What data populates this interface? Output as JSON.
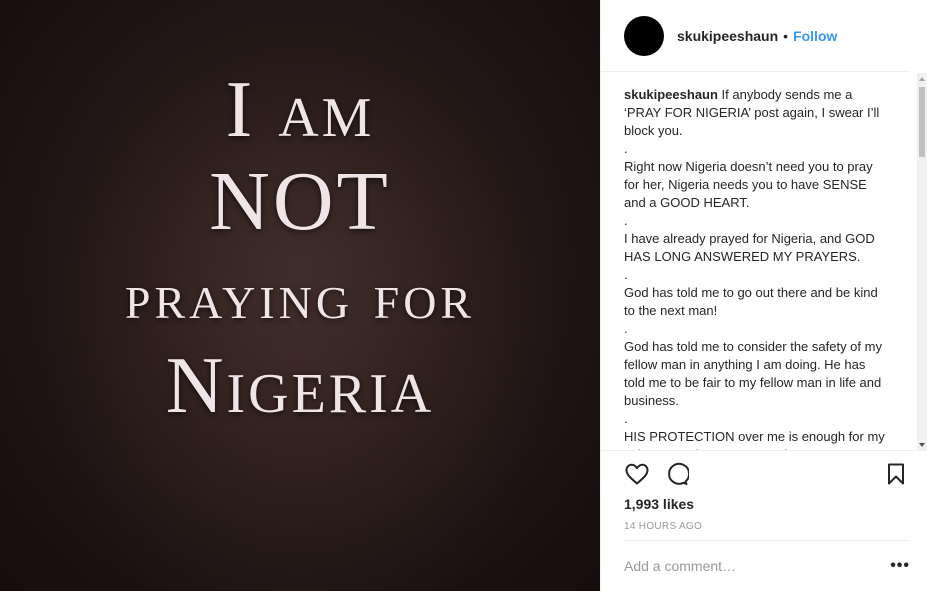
{
  "image": {
    "lines": [
      "I am",
      "NOT",
      "praying for",
      "Nigeria"
    ]
  },
  "header": {
    "username": "skukipeeshaun",
    "separator": "•",
    "follow_label": "Follow"
  },
  "caption": {
    "username": "skukipeeshaun",
    "text": " If anybody sends me a ‘PRAY FOR NIGERIA’ post again, I swear I’ll block you.\n.\nRight now Nigeria doesn’t need you to pray for her, Nigeria needs you to have SENSE and a GOOD HEART.\n.\nI have already prayed for Nigeria, and GOD HAS LONG ANSWERED MY PRAYERS.\n.\nGod has told me to go out there and be kind to the next man!\n.\nGod has told me to consider the safety of my fellow man in anything I am doing. He has told me to be fair to my fellow man in life and business.\n.\nHIS PROTECTION over me is enough for my sake...I need to CURSE and BIND..."
  },
  "actions": {
    "like_icon": "heart-icon",
    "comment_icon": "comment-icon",
    "save_icon": "bookmark-icon"
  },
  "likes": "1,993 likes",
  "timestamp": "14 HOURS AGO",
  "comment": {
    "placeholder": "Add a comment…",
    "more_label": "•••"
  },
  "colors": {
    "link": "#3897f0",
    "text": "#262626",
    "muted": "#999999"
  }
}
